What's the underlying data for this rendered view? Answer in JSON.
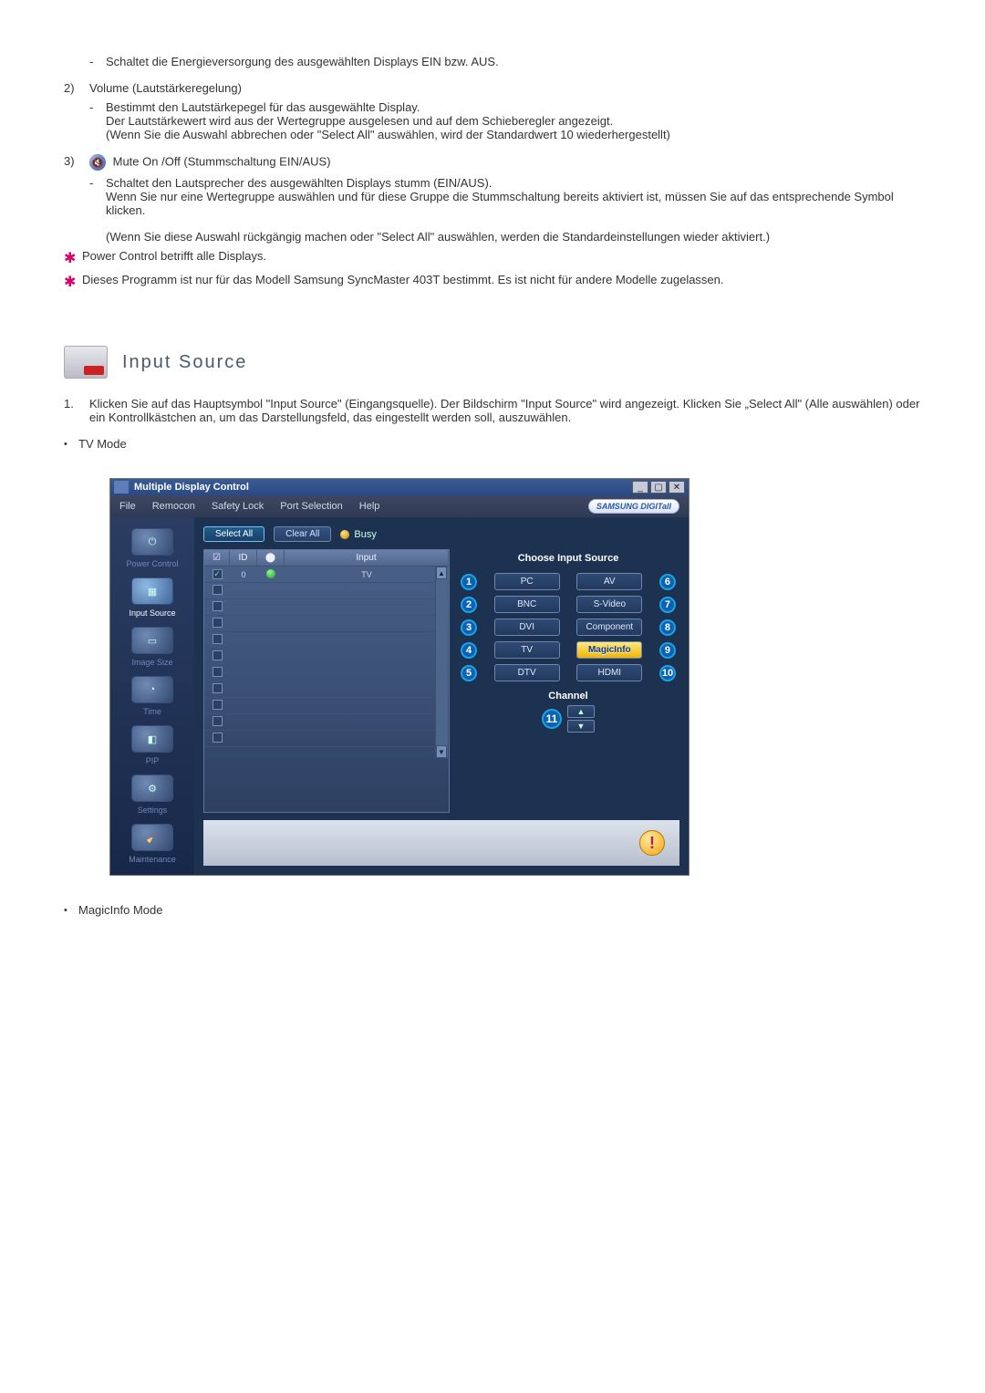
{
  "body": {
    "item1_sub_dash": "-",
    "item1_sub_text": "Schaltet die Energieversorgung des ausgewählten Displays EIN bzw. AUS.",
    "item2_marker": "2)",
    "item2_title": "Volume (Lautstärkeregelung)",
    "item2_sub_dash": "-",
    "item2_sub_a": "Bestimmt den Lautstärkepegel für das ausgewählte Display.",
    "item2_sub_b": "Der Lautstärkewert wird aus der Wertegruppe ausgelesen und auf dem Schieberegler angezeigt.",
    "item2_sub_c": "(Wenn Sie die Auswahl abbrechen oder \"Select All\" auswählen, wird der Standardwert 10 wiederhergestellt)",
    "item3_marker": "3)",
    "item3_title": "Mute On /Off (Stummschaltung EIN/AUS)",
    "item3_sub_dash": "-",
    "item3_sub_a": "Schaltet den Lautsprecher des ausgewählten Displays stumm (EIN/AUS).",
    "item3_sub_b": "Wenn Sie nur eine Wertegruppe auswählen und für diese Gruppe die Stummschaltung bereits aktiviert ist, müssen Sie auf das entsprechende Symbol klicken.",
    "item3_sub_c": "(Wenn Sie diese Auswahl rückgängig machen oder \"Select All\" auswählen, werden die Standardeinstellungen wieder aktiviert.)",
    "star1": "Power Control betrifft alle Displays.",
    "star2": "Dieses Programm ist nur für das Modell Samsung SyncMaster 403T bestimmt. Es ist nicht für andere Modelle zugelassen."
  },
  "section": {
    "title": "Input Source",
    "num1_marker": "1.",
    "num1_text": "Klicken Sie auf das Hauptsymbol \"Input Source\" (Eingangsquelle). Der Bildschirm \"Input Source\" wird angezeigt. Klicken Sie „Select All\" (Alle auswählen) oder ein Kontrollkästchen an, um das Darstellungsfeld, das eingestellt werden soll, auszuwählen.",
    "bullet_tv": "TV Mode",
    "bullet_magic": "MagicInfo Mode"
  },
  "shot": {
    "titlebar": "Multiple Display Control",
    "win_min": "_",
    "win_max": "▢",
    "win_close": "✕",
    "menu": {
      "file": "File",
      "remocon": "Remocon",
      "safety": "Safety Lock",
      "port": "Port Selection",
      "help": "Help",
      "brand": "SAMSUNG DIGITall"
    },
    "sidebar": {
      "power": "Power Control",
      "input": "Input Source",
      "image": "Image Size",
      "time": "Time",
      "pip": "PIP",
      "settings": "Settings",
      "maint": "Maintenance"
    },
    "toolbar": {
      "select": "Select All",
      "clear": "Clear All",
      "busy": "Busy"
    },
    "list": {
      "h_chk": "☑",
      "h_id": "ID",
      "h_st": "⬤",
      "h_in": "Input",
      "row0_id": "0",
      "row0_in": "TV"
    },
    "right": {
      "title": "Choose Input Source",
      "pc": "PC",
      "av": "AV",
      "bnc": "BNC",
      "svideo": "S-Video",
      "dvi": "DVI",
      "component": "Component",
      "tv": "TV",
      "magicinfo": "MagicInfo",
      "dtv": "DTV",
      "hdmi": "HDMI",
      "n1": "1",
      "n2": "2",
      "n3": "3",
      "n4": "4",
      "n5": "5",
      "n6": "6",
      "n7": "7",
      "n8": "8",
      "n9": "9",
      "n10": "10",
      "n11": "11",
      "channel": "Channel",
      "up": "▲",
      "down": "▼"
    },
    "info": "!"
  }
}
